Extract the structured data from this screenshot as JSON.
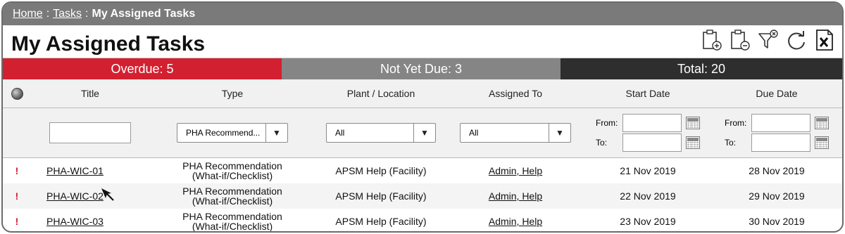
{
  "breadcrumb": {
    "home": "Home",
    "tasks": "Tasks",
    "current": "My Assigned Tasks",
    "sep1": ":",
    "sep2": ":"
  },
  "page": {
    "title": "My Assigned Tasks"
  },
  "summary": {
    "overdue": "Overdue: 5",
    "not_yet_due": "Not Yet Due: 3",
    "total": "Total: 20",
    "overdue_color": "#d32030",
    "not_yet_due_color": "#858585",
    "total_color": "#2e2e2e"
  },
  "columns": [
    "Title",
    "Type",
    "Plant / Location",
    "Assigned To",
    "Start Date",
    "Due Date"
  ],
  "filters": {
    "title_value": "",
    "type_value": "PHA Recommend...",
    "plant_value": "All",
    "assigned_value": "All",
    "from_label": "From:",
    "to_label": "To:"
  },
  "tool_icons": [
    "add-task-icon",
    "edit-task-icon",
    "clear-filter-icon",
    "refresh-icon",
    "export-excel-icon"
  ],
  "rows": [
    {
      "flag": "!",
      "title": "PHA-WIC-01",
      "type_line1": "PHA Recommendation",
      "type_line2": "(What-if/Checklist)",
      "plant": "APSM Help (Facility)",
      "assigned": "Admin, Help",
      "start": "21 Nov 2019",
      "due": "28 Nov 2019"
    },
    {
      "flag": "!",
      "title": "PHA-WIC-02",
      "type_line1": "PHA Recommendation",
      "type_line2": "(What-if/Checklist)",
      "plant": "APSM Help (Facility)",
      "assigned": "Admin, Help",
      "start": "22 Nov 2019",
      "due": "29 Nov 2019"
    },
    {
      "flag": "!",
      "title": "PHA-WIC-03",
      "type_line1": "PHA Recommendation",
      "type_line2": "(What-if/Checklist)",
      "plant": "APSM Help (Facility)",
      "assigned": "Admin, Help",
      "start": "23 Nov 2019",
      "due": "30 Nov 2019"
    }
  ]
}
